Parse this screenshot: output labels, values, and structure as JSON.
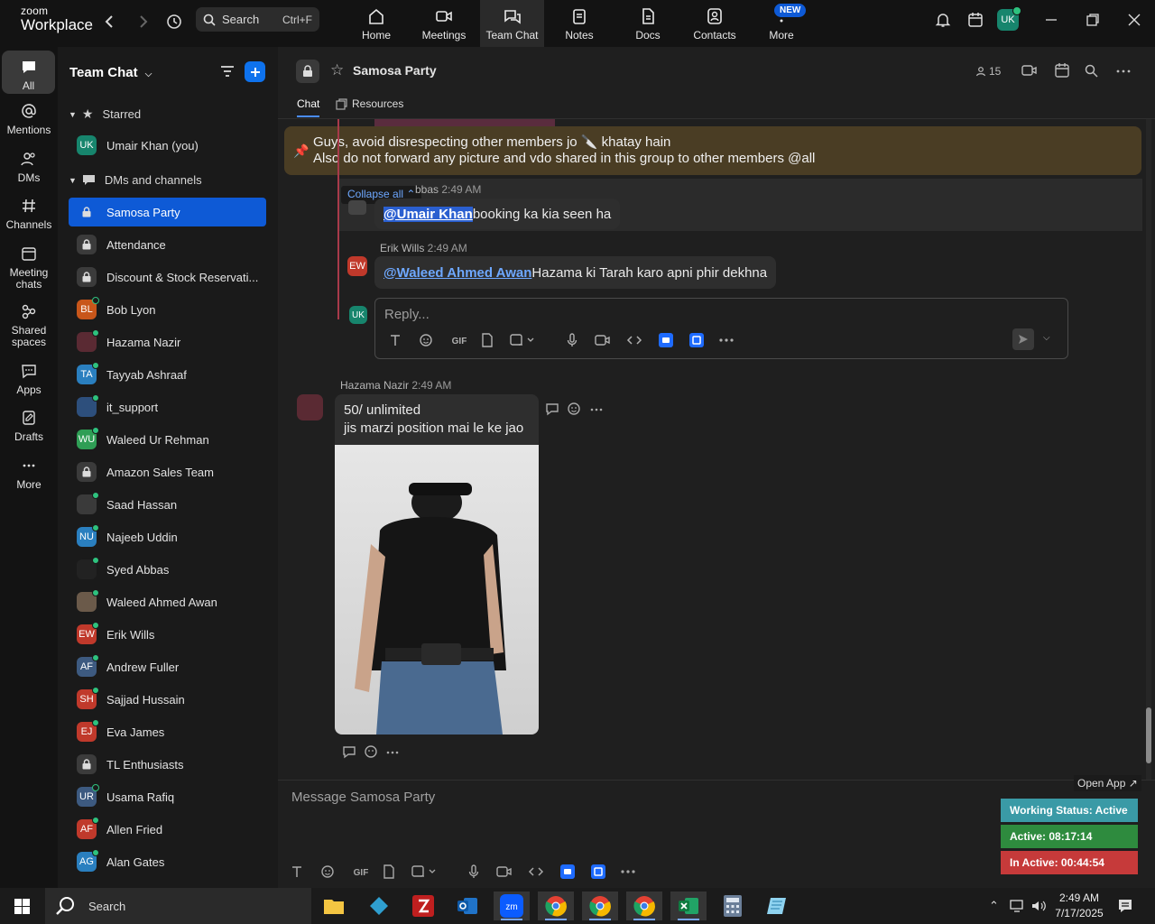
{
  "app": {
    "logo_small": "zoom",
    "logo_big": "Workplace",
    "search_label": "Search",
    "search_shortcut": "Ctrl+F",
    "user_initials": "UK",
    "new_badge": "NEW",
    "tabs": [
      {
        "label": "Home",
        "icon": "home-icon"
      },
      {
        "label": "Meetings",
        "icon": "video-camera-icon"
      },
      {
        "label": "Team Chat",
        "icon": "chat-bubbles-icon"
      },
      {
        "label": "Notes",
        "icon": "notes-icon"
      },
      {
        "label": "Docs",
        "icon": "docs-icon"
      },
      {
        "label": "Contacts",
        "icon": "contacts-icon"
      },
      {
        "label": "More",
        "icon": "more-dots-icon"
      }
    ]
  },
  "rail": [
    {
      "label": "All",
      "icon": "chat-icon"
    },
    {
      "label": "Mentions",
      "icon": "at-icon"
    },
    {
      "label": "DMs",
      "icon": "people-icon"
    },
    {
      "label": "Channels",
      "icon": "hash-icon"
    },
    {
      "label": "Meeting",
      "label2": "chats",
      "icon": "calendar-chat-icon"
    },
    {
      "label": "Shared",
      "label2": "spaces",
      "icon": "shared-spaces-icon"
    },
    {
      "label": "Apps",
      "icon": "apps-icon"
    },
    {
      "label": "Drafts",
      "icon": "drafts-icon"
    },
    {
      "label": "More",
      "icon": "ellipsis-icon"
    }
  ],
  "sidebar": {
    "title": "Team Chat",
    "starred_label": "Starred",
    "dms_label": "DMs and channels",
    "starred": [
      {
        "name": "Umair Khan (you)",
        "initials": "UK",
        "color": "#17856d"
      }
    ],
    "items": [
      {
        "name": "Samosa Party",
        "type": "lock",
        "selected": true
      },
      {
        "name": "Attendance",
        "type": "lock"
      },
      {
        "name": "Discount & Stock Reservati...",
        "type": "lock"
      },
      {
        "name": "Bob Lyon",
        "initials": "BL",
        "color": "#c8561a",
        "status": "away"
      },
      {
        "name": "Hazama Nazir",
        "initials": "",
        "color": "#5a2a33",
        "status": "online"
      },
      {
        "name": "Tayyab Ashraaf",
        "initials": "TA",
        "color": "#2a7fbf",
        "status": "online"
      },
      {
        "name": "it_support",
        "initials": "",
        "color": "#2d4f7c",
        "status": "online"
      },
      {
        "name": "Waleed Ur Rehman",
        "initials": "WU",
        "color": "#2f9e55",
        "status": "online"
      },
      {
        "name": "Amazon Sales Team",
        "type": "lock"
      },
      {
        "name": "Saad Hassan",
        "initials": "",
        "color": "#3a3a3a",
        "status": "online"
      },
      {
        "name": "Najeeb Uddin",
        "initials": "NU",
        "color": "#2a7fbf",
        "status": "online"
      },
      {
        "name": "Syed Abbas",
        "initials": "",
        "color": "#222",
        "status": "online"
      },
      {
        "name": "Waleed Ahmed Awan",
        "initials": "",
        "color": "#6b5a4a",
        "status": "online"
      },
      {
        "name": "Erik Wills",
        "initials": "EW",
        "color": "#c0392b",
        "status": "online"
      },
      {
        "name": "Andrew Fuller",
        "initials": "AF",
        "color": "#3d5a80",
        "status": "online"
      },
      {
        "name": "Sajjad Hussain",
        "initials": "SH",
        "color": "#c0392b",
        "status": "online"
      },
      {
        "name": "Eva James",
        "initials": "EJ",
        "color": "#c0392b",
        "status": "online"
      },
      {
        "name": "TL Enthusiasts",
        "type": "lock"
      },
      {
        "name": "Usama Rafiq",
        "initials": "UR",
        "color": "#3d5a80",
        "status": "away"
      },
      {
        "name": "Allen Fried",
        "initials": "AF",
        "color": "#c0392b",
        "status": "online"
      },
      {
        "name": "Alan Gates",
        "initials": "AG",
        "color": "#2a7fbf",
        "status": "online"
      }
    ]
  },
  "chat": {
    "title": "Samosa Party",
    "member_count": "15",
    "tabs": [
      "Chat",
      "Resources"
    ],
    "pinned": {
      "line1": "Guys, avoid disrespecting other members jo 🔪 khatay hain",
      "line2": "Also do not forward any picture and vdo shared in this group to other members @all"
    },
    "collapse_label": "Collapse all",
    "thread_msg1": {
      "sender_partial": "bbas",
      "time": "2:49 AM",
      "mention": "@Umair Khan",
      "text": " booking ka kia seen ha"
    },
    "thread_msg2": {
      "sender": "Erik Wills",
      "time": "2:49 AM",
      "initials": "EW",
      "mention": "@Waleed Ahmed Awan",
      "text": " Hazama ki Tarah karo apni phir dekhna"
    },
    "reply_placeholder": "Reply...",
    "reply_avatar": "UK",
    "main_msg": {
      "sender": "Hazama Nazir",
      "time": "2:49 AM",
      "line1": "50/ unlimited",
      "line2": "jis marzi position mai le ke jao"
    },
    "composer_placeholder": "Message Samosa Party"
  },
  "overlay": {
    "open_app": "Open App ↗",
    "working_status": "Working Status: Active",
    "active": "Active: 08:17:14",
    "inactive": "In Active: 00:44:54"
  },
  "taskbar": {
    "search": "Search",
    "time": "2:49 AM",
    "date": "7/17/2025"
  }
}
